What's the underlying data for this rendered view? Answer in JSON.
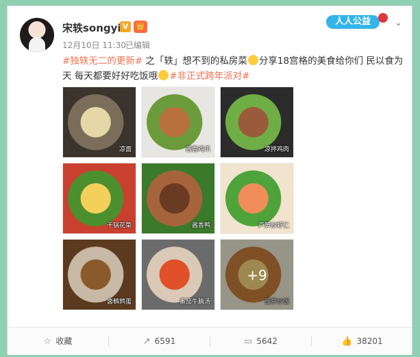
{
  "user": {
    "name": "宋轶songyi",
    "verified_badge": "V",
    "vip_badge": "👑"
  },
  "post": {
    "timestamp": "12月10日 11:30",
    "edited": "已编辑",
    "text_parts": [
      {
        "text": "#独轶无二的更新#",
        "tag": true
      },
      {
        "text": " 之「轶」想不到的私房菜",
        "tag": false
      },
      {
        "text": "分享18宫格的美食给你们 民以食为天 每天都要好好吃饭哦",
        "tag": false
      },
      {
        "text": "#非正式跨年派对#",
        "tag": true
      }
    ]
  },
  "charity": {
    "label": "人人公益"
  },
  "images": [
    {
      "label": "凉面",
      "colors": [
        "#e6d7a8",
        "#7a6d5a",
        "#3a342d"
      ]
    },
    {
      "label": "酱香鸡爪",
      "colors": [
        "#b8713a",
        "#6b9b3a",
        "#e8e6e2"
      ]
    },
    {
      "label": "凉拌鸡肉",
      "colors": [
        "#9a5b3a",
        "#6fae45",
        "#2b2b2b"
      ]
    },
    {
      "label": "干锅花菜",
      "colors": [
        "#f2d05a",
        "#4c8f2e",
        "#c9402e"
      ]
    },
    {
      "label": "酱香鸭",
      "colors": [
        "#6b3a22",
        "#a5643b",
        "#3b7a2b"
      ]
    },
    {
      "label": "芦笋炒虾仁",
      "colors": [
        "#f08d5a",
        "#4ea33a",
        "#f0e4cf"
      ]
    },
    {
      "label": "卤鹌鹑蛋",
      "colors": [
        "#8b5a2b",
        "#c7b9a6",
        "#5b3a1f"
      ]
    },
    {
      "label": "番茄牛腩汤",
      "colors": [
        "#e0502a",
        "#d9c9b6",
        "#6b6b6b"
      ]
    },
    {
      "label": "菠萝炒饭",
      "colors": [
        "#f2d27a",
        "#c47a3a",
        "#e9e3d2"
      ],
      "more": "+9"
    }
  ],
  "actions": {
    "favorite": "收藏",
    "repost": "6591",
    "comment": "5642",
    "like": "38201"
  },
  "icons": [
    "star-icon",
    "repost-icon",
    "comment-icon",
    "thumbs-up-icon",
    "chevron-down-icon"
  ]
}
